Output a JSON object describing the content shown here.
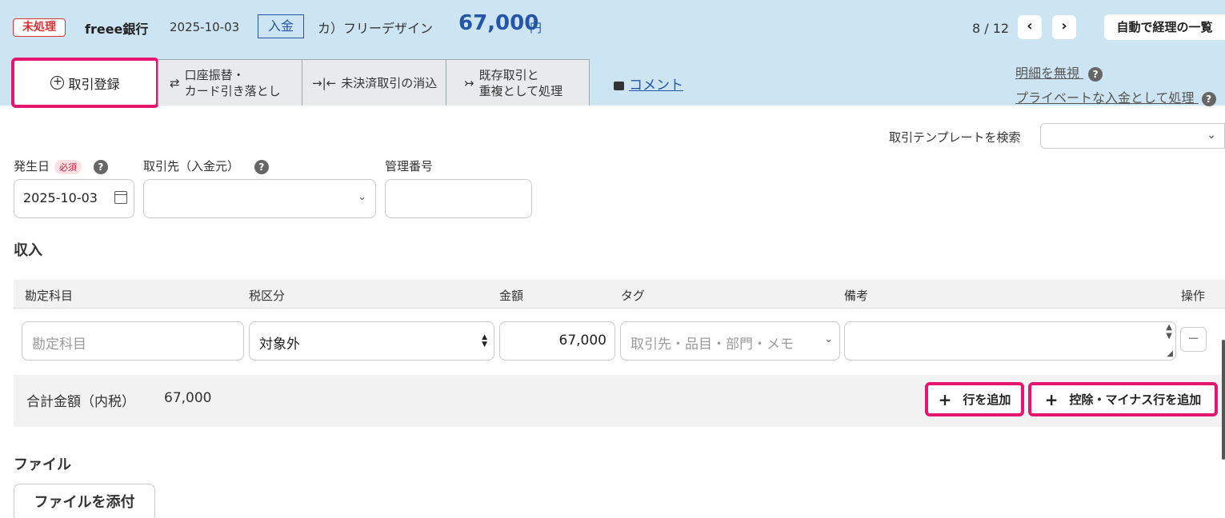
{
  "header": {
    "status": "未処理",
    "bank": "freee銀行",
    "date": "2025-10-03",
    "type": "入金",
    "payee": "カ）フリーデザイン",
    "amount": "67,000",
    "currency": "円",
    "pager": "8 / 12",
    "prev_icon": "chevron-left-icon",
    "next_icon": "chevron-right-icon",
    "list_button": "自動で経理の一覧"
  },
  "tabs": [
    {
      "label": "取引登録",
      "icon": "plus-circle-icon"
    },
    {
      "label_line1": "口座振替・",
      "label_line2": "カード引き落とし",
      "icon": "transfer-icon"
    },
    {
      "label": "未決済取引の消込",
      "icon": "merge-icon"
    },
    {
      "label_line1": "既存取引と",
      "label_line2": "重複として処理",
      "icon": "split-icon"
    }
  ],
  "comment_link": "コメント",
  "right_links": {
    "ignore": "明細を無視",
    "private": "プライベートな入金として処理"
  },
  "template_search": {
    "label": "取引テンプレートを検索",
    "value": ""
  },
  "form": {
    "date_label": "発生日",
    "required_badge": "必須",
    "date_value": "2025-10-03",
    "partner_label": "取引先（入金元）",
    "partner_value": "",
    "ref_label": "管理番号",
    "ref_value": ""
  },
  "income_section": {
    "title": "収入",
    "columns": [
      "勘定科目",
      "税区分",
      "金額",
      "タグ",
      "備考",
      "操作"
    ],
    "row": {
      "account_placeholder": "勘定科目",
      "tax": "対象外",
      "amount": "67,000",
      "tag_placeholder": "取引先・品目・部門・メモ",
      "note": ""
    },
    "total_label": "合計金額（内税）",
    "total_value": "67,000",
    "add_row_button": "行を追加",
    "add_minus_row_button": "控除・マイナス行を追加"
  },
  "file_section": {
    "title": "ファイル",
    "attach_button": "ファイルを添付"
  },
  "colors": {
    "header_bg": "#cde5f2",
    "accent_blue": "#2456a8",
    "highlight": "#e5166f",
    "status_red": "#dd3333"
  }
}
